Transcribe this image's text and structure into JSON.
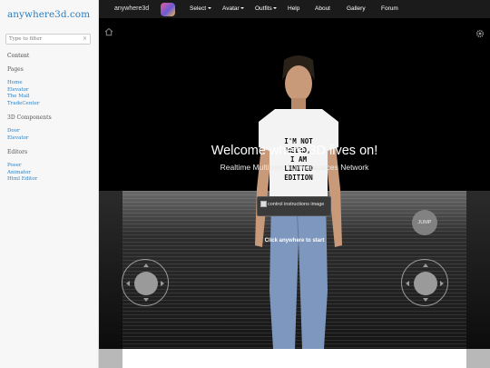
{
  "sidebar": {
    "brand": "anywhere3d.com",
    "filter_placeholder": "Type to filter",
    "filter_clear": "×",
    "content_heading": "Content",
    "pages_heading": "Pages",
    "pages": [
      "Home",
      "Elevator",
      "The Mall",
      "TradeCenter"
    ],
    "components_heading": "3D Components",
    "components": [
      "Door",
      "Elevator"
    ],
    "editors_heading": "Editors",
    "editors": [
      "Poser",
      "Animator",
      "Html Editor"
    ]
  },
  "topnav": {
    "logo": "anywhere3d",
    "items": [
      {
        "label": "Select",
        "dropdown": true
      },
      {
        "label": "Avatar",
        "dropdown": true
      },
      {
        "label": "Outfits",
        "dropdown": true
      },
      {
        "label": "Help",
        "dropdown": false
      },
      {
        "label": "About",
        "dropdown": false
      },
      {
        "label": "Gallery",
        "dropdown": false
      },
      {
        "label": "Forum",
        "dropdown": false
      }
    ]
  },
  "viewport": {
    "welcome": "Welcome where 3D lives on!",
    "tagline": "Realtime Multiuser 3D Webspaces Network",
    "instructions_alt": "control instructions image",
    "click_prompt": "Click anywhere to start",
    "jump_label": "JUMP",
    "shirt_text": [
      "I'M NOT",
      "WEIRD,",
      "I AM",
      "LIMITED",
      "EDITION"
    ]
  },
  "colors": {
    "link": "#2a7fc4",
    "nav_bg": "#1b1b1b",
    "viewport_bg": "#000000"
  },
  "icons": [
    "home-icon",
    "gear-icon",
    "close-icon",
    "chevron-down-icon"
  ]
}
